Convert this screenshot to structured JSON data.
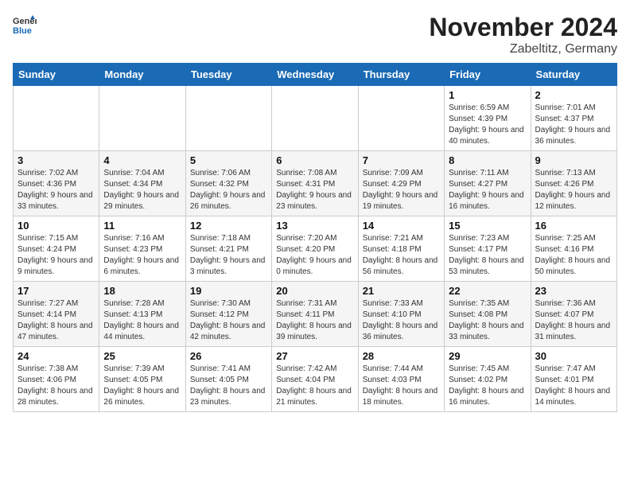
{
  "header": {
    "logo_general": "General",
    "logo_blue": "Blue",
    "month": "November 2024",
    "location": "Zabeltitz, Germany"
  },
  "days_of_week": [
    "Sunday",
    "Monday",
    "Tuesday",
    "Wednesday",
    "Thursday",
    "Friday",
    "Saturday"
  ],
  "weeks": [
    [
      {
        "day": "",
        "sunrise": "",
        "sunset": "",
        "daylight": ""
      },
      {
        "day": "",
        "sunrise": "",
        "sunset": "",
        "daylight": ""
      },
      {
        "day": "",
        "sunrise": "",
        "sunset": "",
        "daylight": ""
      },
      {
        "day": "",
        "sunrise": "",
        "sunset": "",
        "daylight": ""
      },
      {
        "day": "",
        "sunrise": "",
        "sunset": "",
        "daylight": ""
      },
      {
        "day": "1",
        "sunrise": "Sunrise: 6:59 AM",
        "sunset": "Sunset: 4:39 PM",
        "daylight": "Daylight: 9 hours and 40 minutes."
      },
      {
        "day": "2",
        "sunrise": "Sunrise: 7:01 AM",
        "sunset": "Sunset: 4:37 PM",
        "daylight": "Daylight: 9 hours and 36 minutes."
      }
    ],
    [
      {
        "day": "3",
        "sunrise": "Sunrise: 7:02 AM",
        "sunset": "Sunset: 4:36 PM",
        "daylight": "Daylight: 9 hours and 33 minutes."
      },
      {
        "day": "4",
        "sunrise": "Sunrise: 7:04 AM",
        "sunset": "Sunset: 4:34 PM",
        "daylight": "Daylight: 9 hours and 29 minutes."
      },
      {
        "day": "5",
        "sunrise": "Sunrise: 7:06 AM",
        "sunset": "Sunset: 4:32 PM",
        "daylight": "Daylight: 9 hours and 26 minutes."
      },
      {
        "day": "6",
        "sunrise": "Sunrise: 7:08 AM",
        "sunset": "Sunset: 4:31 PM",
        "daylight": "Daylight: 9 hours and 23 minutes."
      },
      {
        "day": "7",
        "sunrise": "Sunrise: 7:09 AM",
        "sunset": "Sunset: 4:29 PM",
        "daylight": "Daylight: 9 hours and 19 minutes."
      },
      {
        "day": "8",
        "sunrise": "Sunrise: 7:11 AM",
        "sunset": "Sunset: 4:27 PM",
        "daylight": "Daylight: 9 hours and 16 minutes."
      },
      {
        "day": "9",
        "sunrise": "Sunrise: 7:13 AM",
        "sunset": "Sunset: 4:26 PM",
        "daylight": "Daylight: 9 hours and 12 minutes."
      }
    ],
    [
      {
        "day": "10",
        "sunrise": "Sunrise: 7:15 AM",
        "sunset": "Sunset: 4:24 PM",
        "daylight": "Daylight: 9 hours and 9 minutes."
      },
      {
        "day": "11",
        "sunrise": "Sunrise: 7:16 AM",
        "sunset": "Sunset: 4:23 PM",
        "daylight": "Daylight: 9 hours and 6 minutes."
      },
      {
        "day": "12",
        "sunrise": "Sunrise: 7:18 AM",
        "sunset": "Sunset: 4:21 PM",
        "daylight": "Daylight: 9 hours and 3 minutes."
      },
      {
        "day": "13",
        "sunrise": "Sunrise: 7:20 AM",
        "sunset": "Sunset: 4:20 PM",
        "daylight": "Daylight: 9 hours and 0 minutes."
      },
      {
        "day": "14",
        "sunrise": "Sunrise: 7:21 AM",
        "sunset": "Sunset: 4:18 PM",
        "daylight": "Daylight: 8 hours and 56 minutes."
      },
      {
        "day": "15",
        "sunrise": "Sunrise: 7:23 AM",
        "sunset": "Sunset: 4:17 PM",
        "daylight": "Daylight: 8 hours and 53 minutes."
      },
      {
        "day": "16",
        "sunrise": "Sunrise: 7:25 AM",
        "sunset": "Sunset: 4:16 PM",
        "daylight": "Daylight: 8 hours and 50 minutes."
      }
    ],
    [
      {
        "day": "17",
        "sunrise": "Sunrise: 7:27 AM",
        "sunset": "Sunset: 4:14 PM",
        "daylight": "Daylight: 8 hours and 47 minutes."
      },
      {
        "day": "18",
        "sunrise": "Sunrise: 7:28 AM",
        "sunset": "Sunset: 4:13 PM",
        "daylight": "Daylight: 8 hours and 44 minutes."
      },
      {
        "day": "19",
        "sunrise": "Sunrise: 7:30 AM",
        "sunset": "Sunset: 4:12 PM",
        "daylight": "Daylight: 8 hours and 42 minutes."
      },
      {
        "day": "20",
        "sunrise": "Sunrise: 7:31 AM",
        "sunset": "Sunset: 4:11 PM",
        "daylight": "Daylight: 8 hours and 39 minutes."
      },
      {
        "day": "21",
        "sunrise": "Sunrise: 7:33 AM",
        "sunset": "Sunset: 4:10 PM",
        "daylight": "Daylight: 8 hours and 36 minutes."
      },
      {
        "day": "22",
        "sunrise": "Sunrise: 7:35 AM",
        "sunset": "Sunset: 4:08 PM",
        "daylight": "Daylight: 8 hours and 33 minutes."
      },
      {
        "day": "23",
        "sunrise": "Sunrise: 7:36 AM",
        "sunset": "Sunset: 4:07 PM",
        "daylight": "Daylight: 8 hours and 31 minutes."
      }
    ],
    [
      {
        "day": "24",
        "sunrise": "Sunrise: 7:38 AM",
        "sunset": "Sunset: 4:06 PM",
        "daylight": "Daylight: 8 hours and 28 minutes."
      },
      {
        "day": "25",
        "sunrise": "Sunrise: 7:39 AM",
        "sunset": "Sunset: 4:05 PM",
        "daylight": "Daylight: 8 hours and 26 minutes."
      },
      {
        "day": "26",
        "sunrise": "Sunrise: 7:41 AM",
        "sunset": "Sunset: 4:05 PM",
        "daylight": "Daylight: 8 hours and 23 minutes."
      },
      {
        "day": "27",
        "sunrise": "Sunrise: 7:42 AM",
        "sunset": "Sunset: 4:04 PM",
        "daylight": "Daylight: 8 hours and 21 minutes."
      },
      {
        "day": "28",
        "sunrise": "Sunrise: 7:44 AM",
        "sunset": "Sunset: 4:03 PM",
        "daylight": "Daylight: 8 hours and 18 minutes."
      },
      {
        "day": "29",
        "sunrise": "Sunrise: 7:45 AM",
        "sunset": "Sunset: 4:02 PM",
        "daylight": "Daylight: 8 hours and 16 minutes."
      },
      {
        "day": "30",
        "sunrise": "Sunrise: 7:47 AM",
        "sunset": "Sunset: 4:01 PM",
        "daylight": "Daylight: 8 hours and 14 minutes."
      }
    ]
  ]
}
